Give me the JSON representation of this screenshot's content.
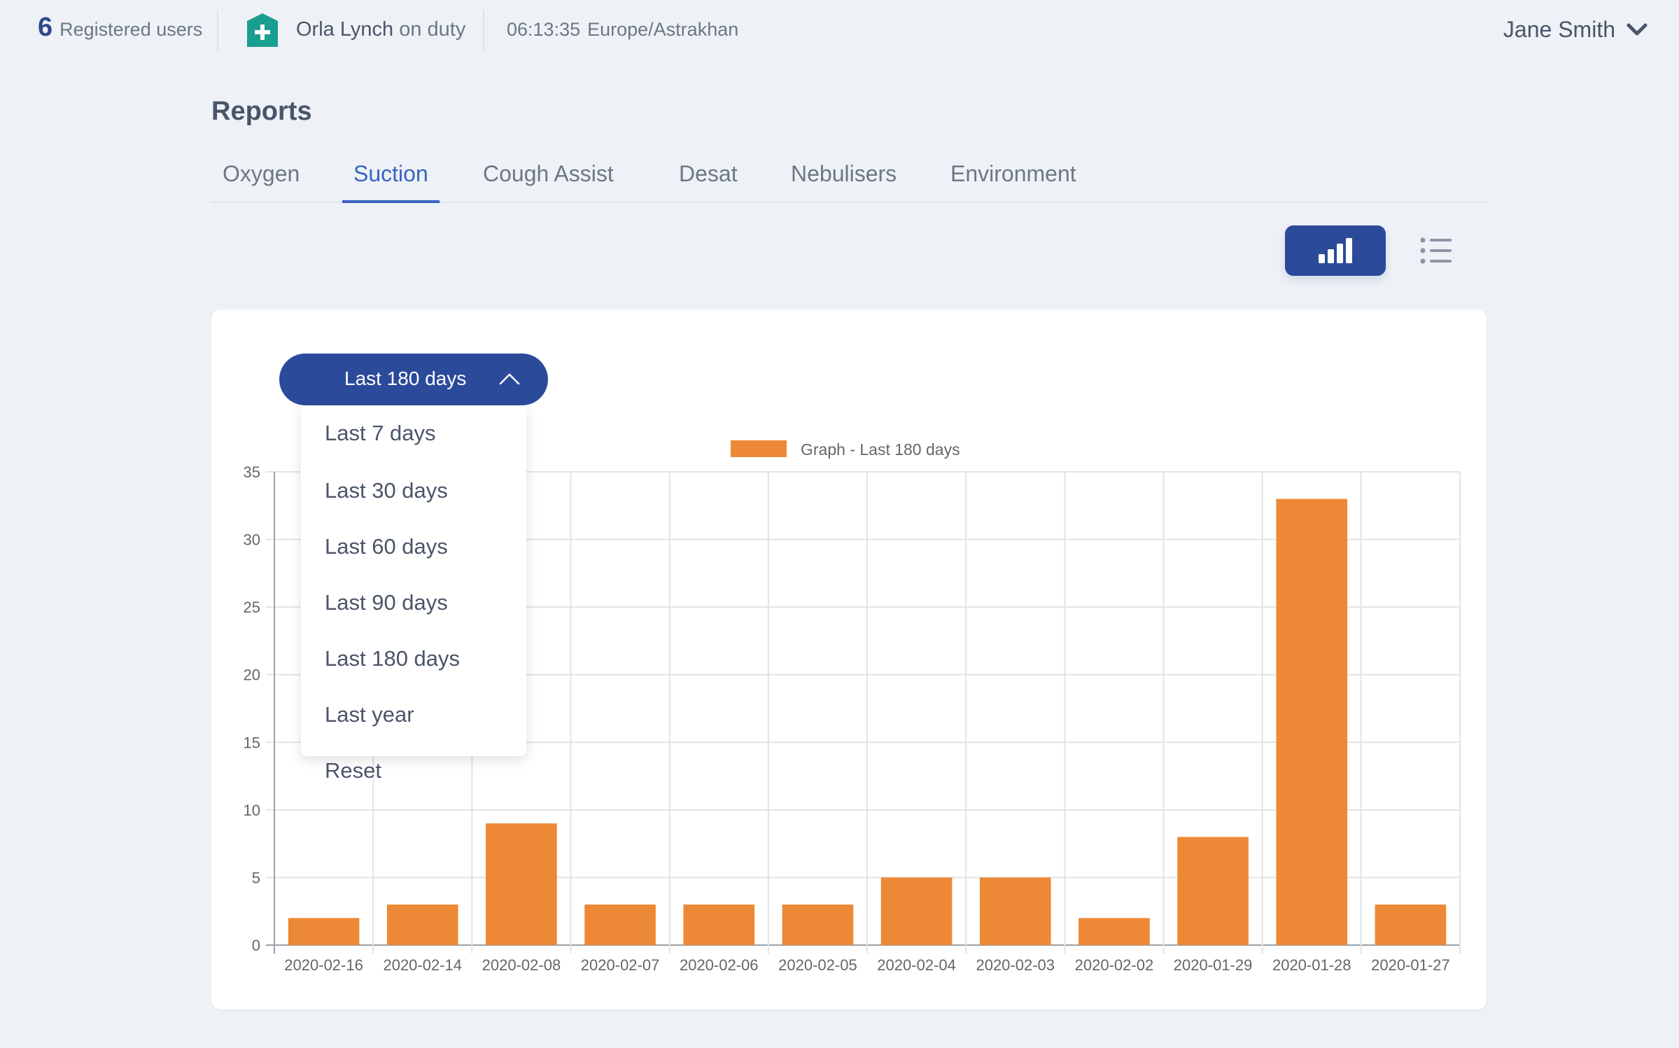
{
  "topbar": {
    "registered_count": "6",
    "registered_label": "Registered users",
    "duty_name": "Orla Lynch",
    "duty_suffix": "on duty",
    "time": "06:13:35",
    "timezone": "Europe/Astrakhan",
    "user_name": "Jane Smith"
  },
  "page": {
    "title": "Reports",
    "tabs": [
      "Oxygen",
      "Suction",
      "Cough Assist",
      "Desat",
      "Nebulisers",
      "Environment"
    ],
    "active_tab": "Suction"
  },
  "filter": {
    "selected": "Last 180 days",
    "options": [
      "Last 7 days",
      "Last 30 days",
      "Last 60 days",
      "Last 90 days",
      "Last 180 days",
      "Last year",
      "Reset"
    ]
  },
  "colors": {
    "accent": "#2c4a9a",
    "active_tab": "#3a64c0",
    "bar": "#ed8936",
    "duty_icon": "#1a9e8f"
  },
  "icons": {
    "duty": "medical-cross-icon",
    "user_menu": "chevron-down-icon",
    "chart_view": "bar-chart-icon",
    "list_view": "list-icon",
    "dropdown": "chevron-up-icon"
  },
  "chart_data": {
    "type": "bar",
    "legend": "Graph - Last 180 days",
    "legend_position": "top",
    "categories": [
      "2020-02-16",
      "2020-02-14",
      "2020-02-08",
      "2020-02-07",
      "2020-02-06",
      "2020-02-05",
      "2020-02-04",
      "2020-02-03",
      "2020-02-02",
      "2020-01-29",
      "2020-01-28",
      "2020-01-27"
    ],
    "series": [
      {
        "name": "Graph - Last 180 days",
        "values": [
          2,
          3,
          9,
          3,
          3,
          3,
          5,
          5,
          2,
          8,
          33,
          3
        ]
      }
    ],
    "ylim": [
      0,
      35
    ],
    "yticks": [
      0,
      5,
      10,
      15,
      20,
      25,
      30,
      35
    ],
    "grid": true
  }
}
